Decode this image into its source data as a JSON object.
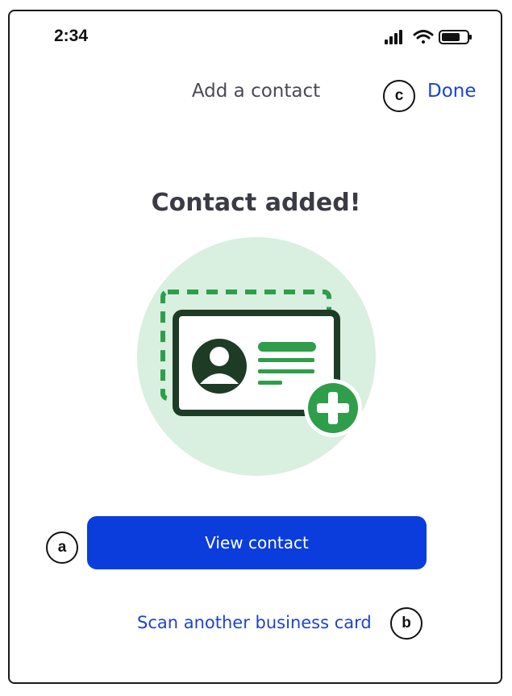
{
  "status_bar": {
    "time": "2:34",
    "icons": [
      "cellular-signal-icon",
      "wifi-icon",
      "battery-icon"
    ]
  },
  "header": {
    "title": "Add a contact",
    "done_label": "Done"
  },
  "main": {
    "headline": "Contact added!",
    "illustration_icon": "contact-card-add-icon",
    "primary_button_label": "View contact",
    "secondary_link_label": "Scan another business card"
  },
  "callouts": {
    "a": "a",
    "b": "b",
    "c": "c"
  },
  "colors": {
    "accent_blue": "#0a3ddb",
    "link_blue": "#1f44c8",
    "illustration_green": "#2e9e4a",
    "illustration_dark": "#1e3b25",
    "illustration_bg": "#d9efe0"
  }
}
